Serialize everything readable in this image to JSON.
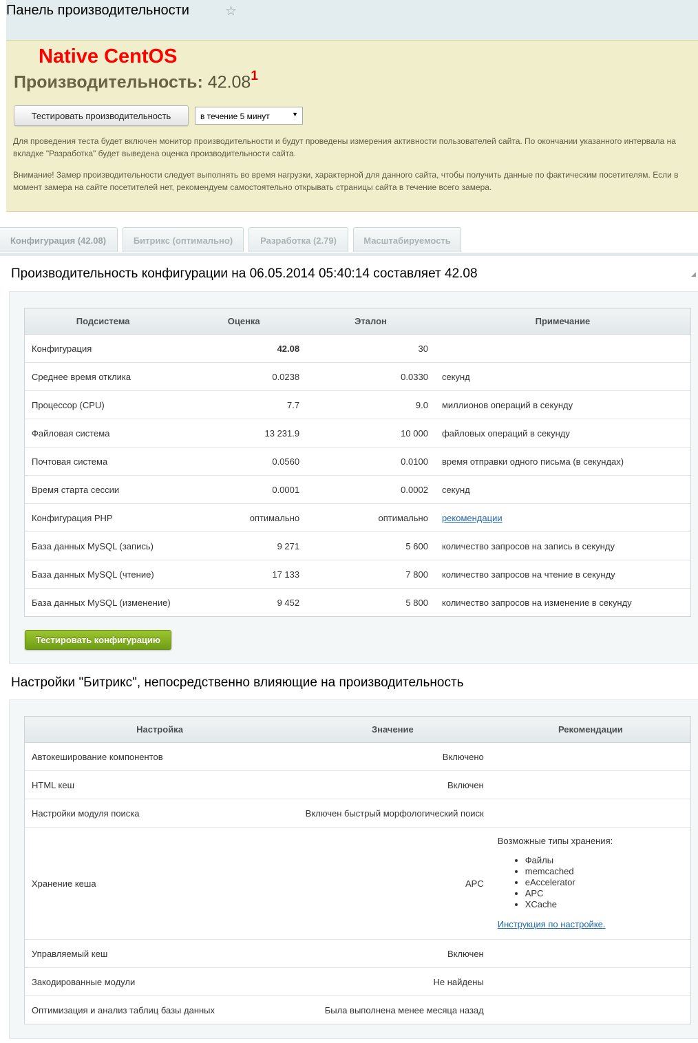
{
  "header": {
    "title": "Панель производительности"
  },
  "notice": {
    "system_label": "Native CentOS",
    "perf_label": "Производительность:",
    "perf_value": "42.08",
    "perf_sup": "1",
    "test_button": "Тестировать производительность",
    "interval_selected": "в течение 5 минут",
    "paragraph1": "Для проведения теста будет включен монитор производительности и будут проведены измерения активности пользователей сайта. По окончании указанного интервала на вкладке \"Разработка\" будет выведена оценка производительности сайта.",
    "paragraph2": "Внимание! Замер производительности следует выполнять во время нагрузки, характерной для данного сайта, чтобы получить данные по фактическим посетителям. Если в момент замера на сайте посетителей нет, рекомендуем самостоятельно открывать страницы сайта в течение всего замера."
  },
  "tabs": [
    {
      "label": "Конфигурация (42.08)"
    },
    {
      "label": "Битрикс (оптимально)"
    },
    {
      "label": "Разработка (2.79)"
    },
    {
      "label": "Масштабируемость"
    }
  ],
  "config": {
    "title": "Производительность конфигурации на 06.05.2014 05:40:14 составляет 42.08",
    "headers": [
      "Подсистема",
      "Оценка",
      "Эталон",
      "Примечание"
    ],
    "rows": [
      {
        "name": "Конфигурация",
        "score": "42.08",
        "ref": "30",
        "note": ""
      },
      {
        "name": "Среднее время отклика",
        "score": "0.0238",
        "ref": "0.0330",
        "note": "секунд"
      },
      {
        "name": "Процессор (CPU)",
        "score": "7.7",
        "ref": "9.0",
        "note": "миллионов операций в секунду"
      },
      {
        "name": "Файловая система",
        "score": "13 231.9",
        "ref": "10 000",
        "note": "файловых операций в секунду"
      },
      {
        "name": "Почтовая система",
        "score": "0.0560",
        "ref": "0.0100",
        "note": "время отправки одного письма (в секундах)"
      },
      {
        "name": "Время старта сессии",
        "score": "0.0001",
        "ref": "0.0002",
        "note": "секунд"
      },
      {
        "name": "Конфигурация PHP",
        "score": "оптимально",
        "ref": "оптимально",
        "note": "рекомендации"
      },
      {
        "name": "База данных MySQL (запись)",
        "score": "9 271",
        "ref": "5 600",
        "note": "количество запросов на запись в секунду"
      },
      {
        "name": "База данных MySQL (чтение)",
        "score": "17 133",
        "ref": "7 800",
        "note": "количество запросов на чтение в секунду"
      },
      {
        "name": "База данных MySQL (изменение)",
        "score": "9 452",
        "ref": "5 800",
        "note": "количество запросов на изменение в секунду"
      }
    ],
    "test_button": "Тестировать конфигурацию"
  },
  "bitrix": {
    "title": "Настройки \"Битрикс\", непосредственно влияющие на производительность",
    "headers": [
      "Настройка",
      "Значение",
      "Рекомендации"
    ],
    "rows": [
      {
        "name": "Автокеширование компонентов",
        "value": "Включено"
      },
      {
        "name": "HTML кеш",
        "value": "Включен"
      },
      {
        "name": "Настройки модуля поиска",
        "value": "Включен быстрый морфологический поиск"
      },
      {
        "name": "Хранение кеша",
        "value": "APC"
      },
      {
        "name": "Управляемый кеш",
        "value": "Включен"
      },
      {
        "name": "Закодированные модули",
        "value": "Не найдены"
      },
      {
        "name": "Оптимизация и анализ таблиц базы данных",
        "value": "Была выполнена менее месяца назад"
      }
    ],
    "cache_recommendation": {
      "intro": "Возможные типы хранения:",
      "types": [
        "Файлы",
        "memcached",
        "eAccelerator",
        "APC",
        "XCache"
      ],
      "link": "Инструкция по настройке."
    }
  }
}
